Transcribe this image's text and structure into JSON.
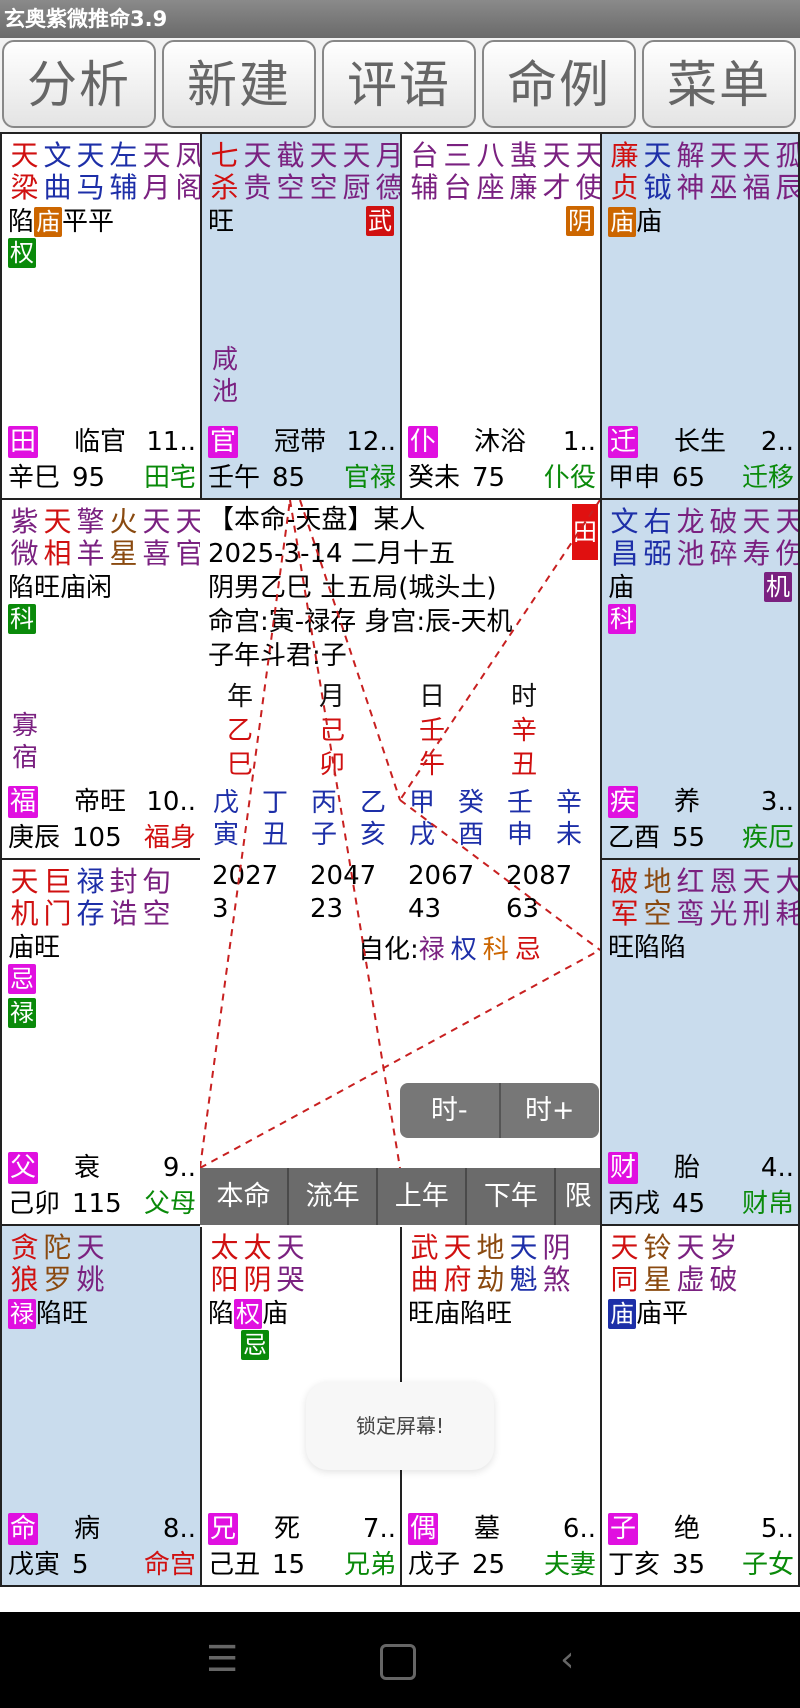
{
  "app_title": "玄奥紫微推命3.9",
  "tabs": [
    "分析",
    "新建",
    "评语",
    "命例",
    "菜单"
  ],
  "colors": {
    "red": "#d01010",
    "blue": "#1d2fa8",
    "purple": "#7a2180",
    "orange": "#cc6600",
    "green": "#0a8a0a",
    "brown": "#8a4a10",
    "magenta": "#e010e0",
    "pink": "#e03080"
  },
  "palaces": {
    "si": {
      "stars": [
        {
          "t": "天梁",
          "c": "red"
        },
        {
          "t": "文曲",
          "c": "blue"
        },
        {
          "t": "天马",
          "c": "blue"
        },
        {
          "t": "左辅",
          "c": "blue"
        },
        {
          "t": "天月",
          "c": "purple"
        },
        {
          "t": "凤阁",
          "c": "purple"
        }
      ],
      "brightness": "陷庙平平",
      "bright_tag_index": 1,
      "mutagen": {
        "t": "权",
        "bg": "green"
      },
      "big_mark": "",
      "minor": [
        "",
        ""
      ],
      "palace_tag": "田",
      "stage": "临官",
      "num": "11..",
      "ganzhi": "辛巳",
      "age": "95",
      "name": "田宅"
    },
    "wu": {
      "stars": [
        {
          "t": "七杀",
          "c": "red"
        },
        {
          "t": "天贵",
          "c": "purple"
        },
        {
          "t": "截空",
          "c": "purple"
        },
        {
          "t": "天空",
          "c": "purple"
        },
        {
          "t": "天厨",
          "c": "purple"
        },
        {
          "t": "月德",
          "c": "purple"
        }
      ],
      "brightness": "旺",
      "mutagen": null,
      "big_mark": "武",
      "minor": [
        "咸",
        "池"
      ],
      "palace_tag": "官",
      "stage": "冠带",
      "num": "12..",
      "ganzhi": "壬午",
      "age": "85",
      "name": "官禄"
    },
    "wei": {
      "stars": [
        {
          "t": "台辅",
          "c": "purple"
        },
        {
          "t": "三台",
          "c": "purple"
        },
        {
          "t": "八座",
          "c": "purple"
        },
        {
          "t": "蜚廉",
          "c": "purple"
        },
        {
          "t": "天才",
          "c": "purple"
        },
        {
          "t": "天使",
          "c": "purple"
        }
      ],
      "brightness": "",
      "mutagen": null,
      "big_mark": "阴",
      "minor": [
        "",
        ""
      ],
      "palace_tag": "仆",
      "stage": "沐浴",
      "num": "1..",
      "ganzhi": "癸未",
      "age": "75",
      "name": "仆役"
    },
    "shen": {
      "stars": [
        {
          "t": "廉贞",
          "c": "red"
        },
        {
          "t": "天钺",
          "c": "blue"
        },
        {
          "t": "解神",
          "c": "purple"
        },
        {
          "t": "天巫",
          "c": "purple"
        },
        {
          "t": "天福",
          "c": "purple"
        },
        {
          "t": "孤辰",
          "c": "purple"
        }
      ],
      "brightness": "庙庙",
      "bright_tag_index": 0,
      "mutagen": null,
      "big_mark": "",
      "minor": [
        "",
        ""
      ],
      "palace_tag": "迁",
      "stage": "长生",
      "num": "2..",
      "ganzhi": "甲申",
      "age": "65",
      "name": "迁移"
    },
    "chen": {
      "stars": [
        {
          "t": "紫微",
          "c": "purple"
        },
        {
          "t": "天相",
          "c": "red"
        },
        {
          "t": "擎羊",
          "c": "purple"
        },
        {
          "t": "火星",
          "c": "brown"
        },
        {
          "t": "天喜",
          "c": "purple"
        },
        {
          "t": "天官",
          "c": "purple"
        }
      ],
      "brightness": "陷旺庙闲",
      "mutagen": {
        "t": "科",
        "bg": "green"
      },
      "big_mark": "",
      "minor": [
        "寡",
        "宿"
      ],
      "palace_tag": "福",
      "stage": "帝旺",
      "num": "10..",
      "ganzhi": "庚辰",
      "age": "105",
      "name": "福身"
    },
    "you": {
      "stars": [
        {
          "t": "文昌",
          "c": "blue"
        },
        {
          "t": "右弼",
          "c": "blue"
        },
        {
          "t": "龙池",
          "c": "purple"
        },
        {
          "t": "破碎",
          "c": "purple"
        },
        {
          "t": "天寿",
          "c": "purple"
        },
        {
          "t": "天伤",
          "c": "purple"
        }
      ],
      "brightness": "庙",
      "mutagen": {
        "t": "科",
        "bg": "magenta"
      },
      "big_mark": "机",
      "minor": [
        "",
        ""
      ],
      "palace_tag": "疾",
      "stage": "养",
      "num": "3..",
      "ganzhi": "乙酉",
      "age": "55",
      "name": "疾厄"
    },
    "mao": {
      "stars": [
        {
          "t": "天机",
          "c": "red"
        },
        {
          "t": "巨门",
          "c": "red"
        },
        {
          "t": "禄存",
          "c": "blue"
        },
        {
          "t": "封诰",
          "c": "purple"
        },
        {
          "t": "旬空",
          "c": "purple"
        }
      ],
      "brightness": "庙旺",
      "mutagen": {
        "t": "忌",
        "bg": "magenta"
      },
      "mutagen2": {
        "t": "禄",
        "bg": "green"
      },
      "big_mark": "",
      "minor": [
        "",
        ""
      ],
      "palace_tag": "父",
      "stage": "衰",
      "num": "9..",
      "ganzhi": "己卯",
      "age": "115",
      "name": "父母"
    },
    "xu": {
      "stars": [
        {
          "t": "破军",
          "c": "red"
        },
        {
          "t": "地空",
          "c": "brown"
        },
        {
          "t": "红鸾",
          "c": "purple"
        },
        {
          "t": "恩光",
          "c": "purple"
        },
        {
          "t": "天刑",
          "c": "purple"
        },
        {
          "t": "大耗",
          "c": "purple"
        }
      ],
      "brightness": "旺陷陷",
      "mutagen": null,
      "big_mark": "",
      "minor": [
        "",
        ""
      ],
      "palace_tag": "财",
      "stage": "胎",
      "num": "4..",
      "ganzhi": "丙戌",
      "age": "45",
      "name": "财帛"
    },
    "yin": {
      "stars": [
        {
          "t": "贪狼",
          "c": "red"
        },
        {
          "t": "陀罗",
          "c": "brown"
        },
        {
          "t": "天姚",
          "c": "purple"
        }
      ],
      "brightness": "陷旺",
      "lead_tag": {
        "t": "禄",
        "bg": "magenta"
      },
      "mutagen": null,
      "big_mark": "",
      "minor": [
        "",
        ""
      ],
      "palace_tag": "命",
      "stage": "病",
      "num": "8..",
      "ganzhi": "戊寅",
      "age": "5",
      "name": "命宫"
    },
    "chou": {
      "stars": [
        {
          "t": "太阳",
          "c": "red"
        },
        {
          "t": "太阴",
          "c": "red"
        },
        {
          "t": "天哭",
          "c": "purple"
        }
      ],
      "brightness": "陷权庙",
      "bright_tag_index": 1,
      "bright_tag_bg": "magenta",
      "mutagen": {
        "t": "忌",
        "bg": "green"
      },
      "mut_offset": 1,
      "big_mark": "",
      "minor": [
        "",
        ""
      ],
      "palace_tag": "兄",
      "stage": "死",
      "num": "7..",
      "ganzhi": "己丑",
      "age": "15",
      "name": "兄弟"
    },
    "zi": {
      "stars": [
        {
          "t": "武曲",
          "c": "red"
        },
        {
          "t": "天府",
          "c": "red"
        },
        {
          "t": "地劫",
          "c": "brown"
        },
        {
          "t": "天魁",
          "c": "blue"
        },
        {
          "t": "阴煞",
          "c": "purple"
        }
      ],
      "brightness": "旺庙陷旺",
      "mutagen": null,
      "big_mark": "",
      "minor": [
        "",
        ""
      ],
      "palace_tag": "偶",
      "stage": "墓",
      "num": "6..",
      "ganzhi": "戊子",
      "age": "25",
      "name": "夫妻"
    },
    "hai": {
      "stars": [
        {
          "t": "天同",
          "c": "red"
        },
        {
          "t": "铃星",
          "c": "brown"
        },
        {
          "t": "天虚",
          "c": "purple"
        },
        {
          "t": "岁破",
          "c": "purple"
        }
      ],
      "brightness": "庙庙平",
      "bright_tag_index": 0,
      "bright_tag_bg": "blue",
      "mutagen": null,
      "big_mark": "",
      "minor": [
        "",
        ""
      ],
      "palace_tag": "子",
      "stage": "绝",
      "num": "5..",
      "ganzhi": "丁亥",
      "age": "35",
      "name": "子女"
    }
  },
  "center": {
    "line1": "【本命-天盘】某人",
    "line2": "2025-3-14  二月十五",
    "line3": "阴男乙巳  土五局(城头土)",
    "line4": "命宫:寅-禄存  身宫:辰-天机",
    "line5": "子年斗君:子",
    "corner_mark": "田",
    "pillar_heads": [
      "年",
      "月",
      "日",
      "时"
    ],
    "pillar_stems": [
      "乙",
      "己",
      "壬",
      "辛"
    ],
    "pillar_branches": [
      "巳",
      "卯",
      "午",
      "丑"
    ],
    "dayun_stems": [
      "戊",
      "丁",
      "丙",
      "乙",
      "甲",
      "癸",
      "壬",
      "辛"
    ],
    "dayun_branches": [
      "寅",
      "丑",
      "子",
      "亥",
      "戌",
      "酉",
      "申",
      "未"
    ],
    "years": [
      "2027",
      "2047",
      "2067",
      "2087"
    ],
    "ages": [
      "3",
      "23",
      "43",
      "63"
    ],
    "self_hua_label": "自化:",
    "self_hua": [
      {
        "t": "禄",
        "c": "purple"
      },
      {
        "t": "权",
        "c": "blue"
      },
      {
        "t": "科",
        "c": "orange"
      },
      {
        "t": "忌",
        "c": "red"
      }
    ]
  },
  "hour_controls": [
    "时-",
    "时+"
  ],
  "mode_buttons": [
    "本命",
    "流年",
    "上年",
    "下年",
    "限"
  ],
  "toast": "锁定屏幕!",
  "nav_icons": [
    "menu-icon",
    "home-icon",
    "back-icon"
  ]
}
